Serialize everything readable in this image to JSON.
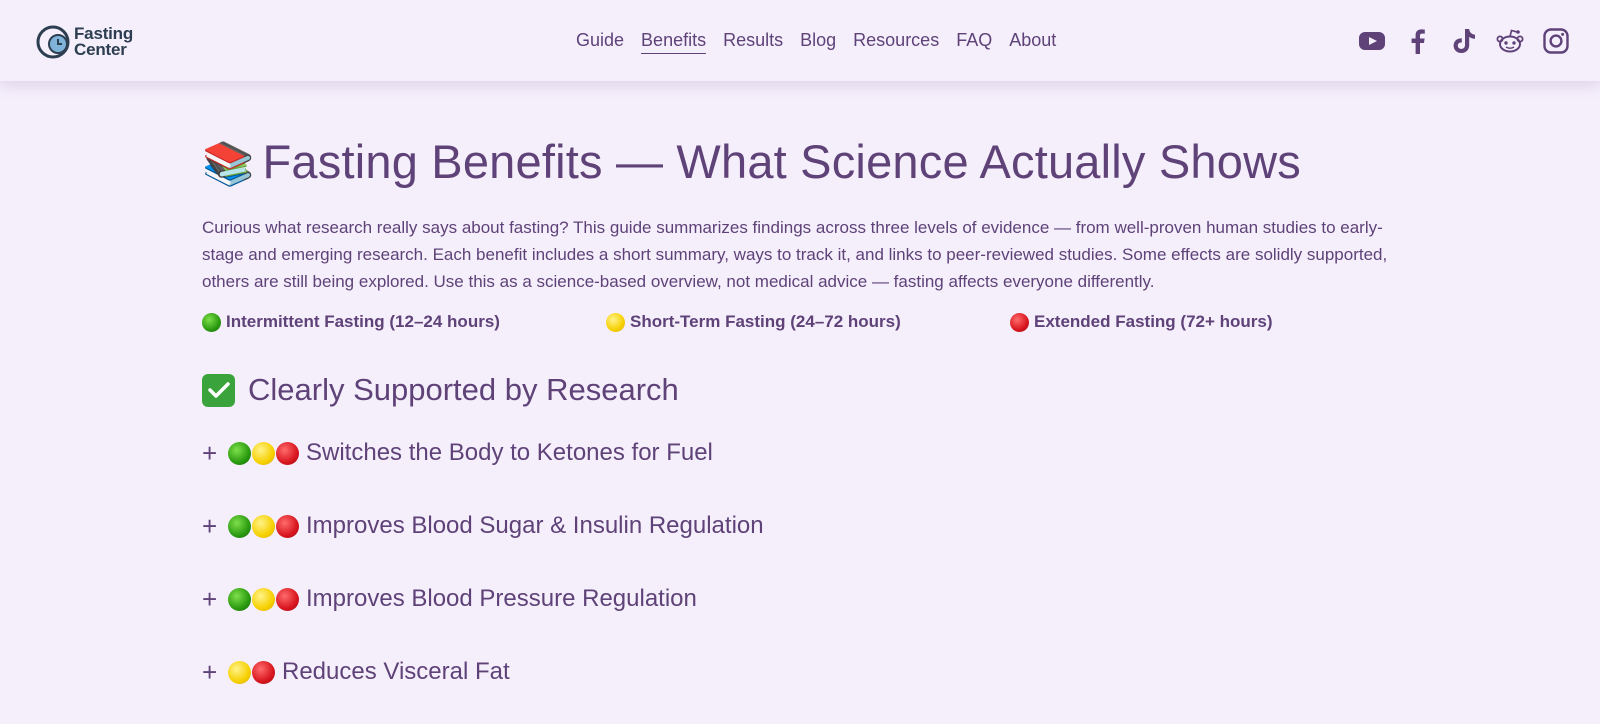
{
  "header": {
    "logo_line1": "Fasting",
    "logo_line2": "Center",
    "nav": [
      "Guide",
      "Benefits",
      "Results",
      "Blog",
      "Resources",
      "FAQ",
      "About"
    ],
    "active_nav": "Benefits",
    "social_icons": [
      "youtube-icon",
      "facebook-icon",
      "tiktok-icon",
      "reddit-icon",
      "instagram-icon"
    ]
  },
  "page": {
    "title_emoji": "📚",
    "title": "Fasting Benefits — What Science Actually Shows",
    "intro": "Curious what research really says about fasting? This guide summarizes findings across three levels of evidence — from well-proven human studies to early-stage and emerging research. Each benefit includes a short summary, ways to track it, and links to peer-reviewed studies. Some effects are solidly supported, others are still being explored. Use this as a science-based overview, not medical advice — fasting affects everyone differently.",
    "legend": [
      {
        "color": "green",
        "label": "Intermittent Fasting (12–24 hours)"
      },
      {
        "color": "yellow",
        "label": "Short-Term Fasting (24–72 hours)"
      },
      {
        "color": "red",
        "label": "Extended Fasting (72+ hours)"
      }
    ],
    "section_title": "Clearly Supported by Research",
    "items": [
      {
        "toggle": "+",
        "dots": [
          "green",
          "yellow",
          "red"
        ],
        "label": "Switches the Body to Ketones for Fuel"
      },
      {
        "toggle": "+",
        "dots": [
          "green",
          "yellow",
          "red"
        ],
        "label": "Improves Blood Sugar & Insulin Regulation"
      },
      {
        "toggle": "+",
        "dots": [
          "green",
          "yellow",
          "red"
        ],
        "label": "Improves Blood Pressure Regulation"
      },
      {
        "toggle": "+",
        "dots": [
          "yellow",
          "red"
        ],
        "label": "Reduces Visceral Fat"
      }
    ]
  },
  "colors": {
    "text": "#5e4278",
    "background": "#f5effc",
    "green": "#2a9a10",
    "yellow": "#f6d000",
    "red": "#d8161f"
  }
}
